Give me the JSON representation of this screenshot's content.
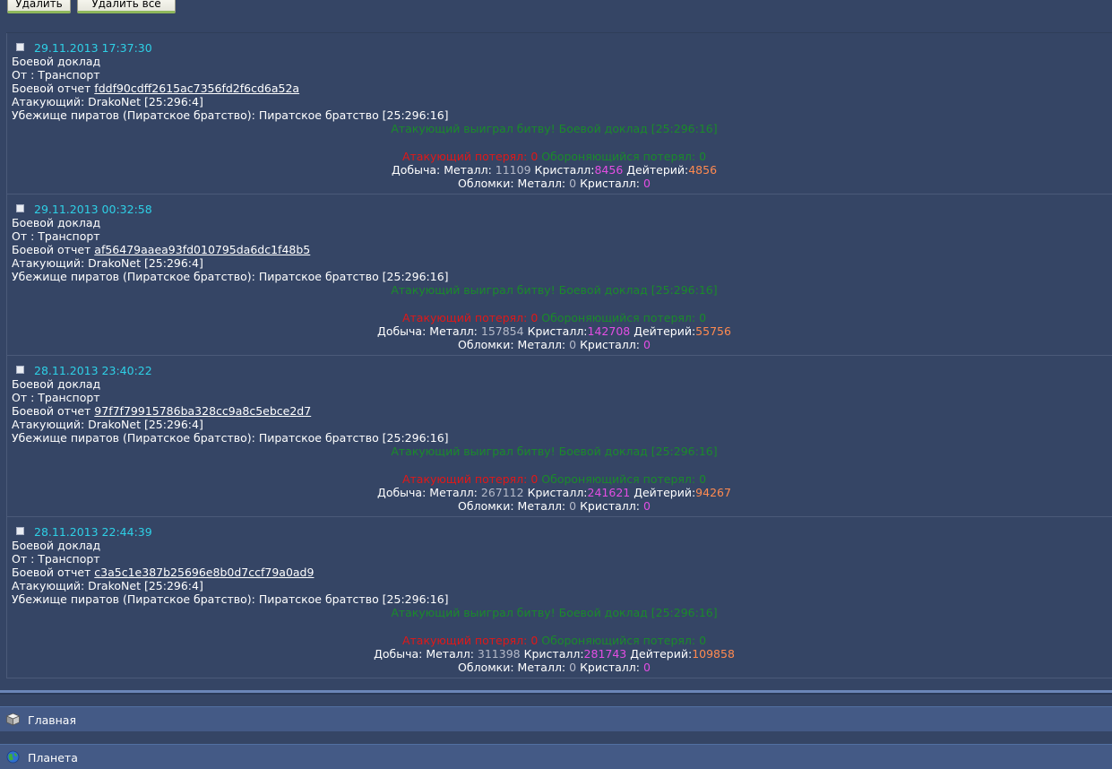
{
  "toolbar": {
    "delete_label": "Удалить",
    "delete_all_label": "Удалить все"
  },
  "messages": [
    {
      "date": "29.11.2013 17:37:30",
      "title": "Боевой доклад",
      "from": "От : Транспорт",
      "report_prefix": "Боевой отчет",
      "report_hash": "fddf90cdff2615ac7356fd2f6cd6a52a",
      "attacker": "Атакующий: DrakoNet [25:296:4]",
      "defender": "Убежище пиратов (Пиратское братство): Пиратское братство [25:296:16]",
      "winner": "Атакующий выиграл битву! Боевой доклад [25:296:16]",
      "att_lost_label": "Атакующий потерял:",
      "att_lost": "0",
      "def_lost_label": "Обороняющийся потерял:",
      "def_lost": "0",
      "loot_label": "Добыча:",
      "loot_metal_label": "Металл:",
      "loot_metal": "11109",
      "loot_crystal_label": "Кристалл:",
      "loot_crystal": "8456",
      "loot_deut_label": "Дейтерий:",
      "loot_deut": "4856",
      "debris_label": "Обломки:",
      "debris_metal_label": "Металл:",
      "debris_metal": "0",
      "debris_crystal_label": "Кристалл:",
      "debris_crystal": "0"
    },
    {
      "date": "29.11.2013 00:32:58",
      "title": "Боевой доклад",
      "from": "От : Транспорт",
      "report_prefix": "Боевой отчет",
      "report_hash": "af56479aaea93fd010795da6dc1f48b5",
      "attacker": "Атакующий: DrakoNet [25:296:4]",
      "defender": "Убежище пиратов (Пиратское братство): Пиратское братство [25:296:16]",
      "winner": "Атакующий выиграл битву! Боевой доклад [25:296:16]",
      "att_lost_label": "Атакующий потерял:",
      "att_lost": "0",
      "def_lost_label": "Обороняющийся потерял:",
      "def_lost": "0",
      "loot_label": "Добыча:",
      "loot_metal_label": "Металл:",
      "loot_metal": "157854",
      "loot_crystal_label": "Кристалл:",
      "loot_crystal": "142708",
      "loot_deut_label": "Дейтерий:",
      "loot_deut": "55756",
      "debris_label": "Обломки:",
      "debris_metal_label": "Металл:",
      "debris_metal": "0",
      "debris_crystal_label": "Кристалл:",
      "debris_crystal": "0"
    },
    {
      "date": "28.11.2013 23:40:22",
      "title": "Боевой доклад",
      "from": "От : Транспорт",
      "report_prefix": "Боевой отчет",
      "report_hash": "97f7f79915786ba328cc9a8c5ebce2d7",
      "attacker": "Атакующий: DrakoNet [25:296:4]",
      "defender": "Убежище пиратов (Пиратское братство): Пиратское братство [25:296:16]",
      "winner": "Атакующий выиграл битву! Боевой доклад [25:296:16]",
      "att_lost_label": "Атакующий потерял:",
      "att_lost": "0",
      "def_lost_label": "Обороняющийся потерял:",
      "def_lost": "0",
      "loot_label": "Добыча:",
      "loot_metal_label": "Металл:",
      "loot_metal": "267112",
      "loot_crystal_label": "Кристалл:",
      "loot_crystal": "241621",
      "loot_deut_label": "Дейтерий:",
      "loot_deut": "94267",
      "debris_label": "Обломки:",
      "debris_metal_label": "Металл:",
      "debris_metal": "0",
      "debris_crystal_label": "Кристалл:",
      "debris_crystal": "0"
    },
    {
      "date": "28.11.2013 22:44:39",
      "title": "Боевой доклад",
      "from": "От : Транспорт",
      "report_prefix": "Боевой отчет",
      "report_hash": "c3a5c1e387b25696e8b0d7ccf79a0ad9",
      "attacker": "Атакующий: DrakoNet [25:296:4]",
      "defender": "Убежище пиратов (Пиратское братство): Пиратское братство [25:296:16]",
      "winner": "Атакующий выиграл битву! Боевой доклад [25:296:16]",
      "att_lost_label": "Атакующий потерял:",
      "att_lost": "0",
      "def_lost_label": "Обороняющийся потерял:",
      "def_lost": "0",
      "loot_label": "Добыча:",
      "loot_metal_label": "Металл:",
      "loot_metal": "311398",
      "loot_crystal_label": "Кристалл:",
      "loot_crystal": "281743",
      "loot_deut_label": "Дейтерий:",
      "loot_deut": "109858",
      "debris_label": "Обломки:",
      "debris_metal_label": "Металл:",
      "debris_metal": "0",
      "debris_crystal_label": "Кристалл:",
      "debris_crystal": "0"
    }
  ],
  "nav": [
    {
      "label": "Главная",
      "icon": "home-cube-icon"
    },
    {
      "label": "Планета",
      "icon": "planet-globe-icon"
    }
  ],
  "colors": {
    "background": "#354565",
    "date": "#2ed0e6",
    "win": "#1a8a2a",
    "lost": "#e01818",
    "crystal": "#e34ee3",
    "deuterium": "#ff8a50"
  }
}
